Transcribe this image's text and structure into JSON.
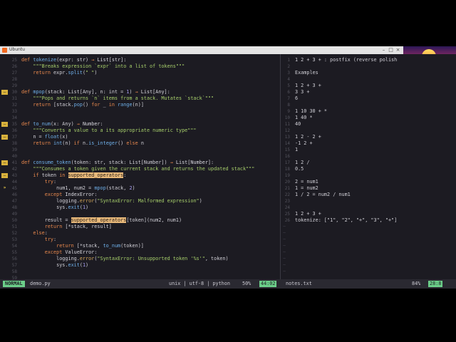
{
  "window": {
    "title": "Ubuntu"
  },
  "left_pane": {
    "lines": [
      {
        "sign": "",
        "num": "25",
        "segs": [
          {
            "c": "kw",
            "t": "def "
          },
          {
            "c": "fn",
            "t": "tokenize"
          },
          {
            "c": "",
            "t": "(expr: str) "
          },
          {
            "c": "kw",
            "t": "→ "
          },
          {
            "c": "ty",
            "t": "List[str]:"
          }
        ]
      },
      {
        "sign": "",
        "num": "26",
        "segs": [
          {
            "c": "str",
            "t": "    \"\"\"Breaks expression `expr` into a list of tokens\"\"\""
          }
        ]
      },
      {
        "sign": "",
        "num": "27",
        "segs": [
          {
            "c": "kw",
            "t": "    return "
          },
          {
            "c": "",
            "t": "expr."
          },
          {
            "c": "fn",
            "t": "split"
          },
          {
            "c": "",
            "t": "("
          },
          {
            "c": "str",
            "t": "\" \""
          },
          {
            "c": "",
            "t": ")"
          }
        ]
      },
      {
        "sign": "",
        "num": "28",
        "segs": []
      },
      {
        "sign": "",
        "num": "29",
        "segs": []
      },
      {
        "sign": "warn",
        "num": "30",
        "segs": [
          {
            "c": "kw",
            "t": "def "
          },
          {
            "c": "fn",
            "t": "mpop"
          },
          {
            "c": "",
            "t": "(stack: List[Any], n: int = "
          },
          {
            "c": "lit",
            "t": "1"
          },
          {
            "c": "",
            "t": ") "
          },
          {
            "c": "kw",
            "t": "→ "
          },
          {
            "c": "ty",
            "t": "List[Any]:"
          }
        ]
      },
      {
        "sign": "",
        "num": "31",
        "segs": [
          {
            "c": "str",
            "t": "    \"\"\"Pops and returns `n` items from a stack. Mutates `stack`\"\"\""
          }
        ]
      },
      {
        "sign": "",
        "num": "32",
        "segs": [
          {
            "c": "kw",
            "t": "    return "
          },
          {
            "c": "",
            "t": "[stack."
          },
          {
            "c": "fn",
            "t": "pop"
          },
          {
            "c": "",
            "t": "() "
          },
          {
            "c": "kw",
            "t": "for "
          },
          {
            "c": "",
            "t": "_ "
          },
          {
            "c": "kw",
            "t": "in "
          },
          {
            "c": "fn",
            "t": "range"
          },
          {
            "c": "",
            "t": "(n)]"
          }
        ]
      },
      {
        "sign": "",
        "num": "33",
        "segs": []
      },
      {
        "sign": "",
        "num": "34",
        "segs": []
      },
      {
        "sign": "warn",
        "num": "35",
        "segs": [
          {
            "c": "kw",
            "t": "def "
          },
          {
            "c": "fn",
            "t": "to_num"
          },
          {
            "c": "",
            "t": "(x: Any) "
          },
          {
            "c": "kw",
            "t": "→ "
          },
          {
            "c": "ty",
            "t": "Number:"
          }
        ]
      },
      {
        "sign": "",
        "num": "36",
        "segs": [
          {
            "c": "str",
            "t": "    \"\"\"Converts a value to a its appropriate numeric type\"\"\""
          }
        ]
      },
      {
        "sign": "warn",
        "num": "37",
        "segs": [
          {
            "c": "",
            "t": "    n = "
          },
          {
            "c": "fn",
            "t": "float"
          },
          {
            "c": "",
            "t": "(x)"
          }
        ]
      },
      {
        "sign": "",
        "num": "38",
        "segs": [
          {
            "c": "kw",
            "t": "    return "
          },
          {
            "c": "fn",
            "t": "int"
          },
          {
            "c": "",
            "t": "(n) "
          },
          {
            "c": "kw",
            "t": "if "
          },
          {
            "c": "",
            "t": "n."
          },
          {
            "c": "fn",
            "t": "is_integer"
          },
          {
            "c": "",
            "t": "() "
          },
          {
            "c": "kw",
            "t": "else "
          },
          {
            "c": "",
            "t": "n"
          }
        ]
      },
      {
        "sign": "",
        "num": "39",
        "segs": []
      },
      {
        "sign": "",
        "num": "40",
        "segs": []
      },
      {
        "sign": "warn",
        "num": "41",
        "segs": [
          {
            "c": "kw",
            "t": "def "
          },
          {
            "c": "fn",
            "t": "consume_token"
          },
          {
            "c": "",
            "t": "(token: str, stack: List[Number]) "
          },
          {
            "c": "kw",
            "t": "→ "
          },
          {
            "c": "ty",
            "t": "List[Number]:"
          }
        ]
      },
      {
        "sign": "",
        "num": "42",
        "segs": [
          {
            "c": "str",
            "t": "    \"\"\"Consumes a token given the current stack and returns the updated stack\"\"\""
          }
        ]
      },
      {
        "sign": "warn",
        "num": "43",
        "segs": [
          {
            "c": "kw",
            "t": "    if "
          },
          {
            "c": "",
            "t": "token "
          },
          {
            "c": "kw",
            "t": "in "
          },
          {
            "c": "hl",
            "t": "supported_operators"
          },
          {
            "c": "",
            "t": ":"
          }
        ]
      },
      {
        "sign": "",
        "num": "44",
        "segs": [
          {
            "c": "kw",
            "t": "        try"
          },
          {
            "c": "",
            "t": ":"
          }
        ]
      },
      {
        "sign": "arrow",
        "num": "45",
        "segs": [
          {
            "c": "",
            "t": "            num1, num2 = "
          },
          {
            "c": "fn",
            "t": "mpop"
          },
          {
            "c": "",
            "t": "(stack, "
          },
          {
            "c": "lit",
            "t": "2"
          },
          {
            "c": "",
            "t": ")"
          }
        ]
      },
      {
        "sign": "",
        "num": "46",
        "segs": [
          {
            "c": "kw",
            "t": "        except "
          },
          {
            "c": "ty",
            "t": "IndexError"
          },
          {
            "c": "",
            "t": ":"
          }
        ]
      },
      {
        "sign": "",
        "num": "47",
        "segs": [
          {
            "c": "",
            "t": "            logging."
          },
          {
            "c": "ec",
            "t": "error"
          },
          {
            "c": "",
            "t": "("
          },
          {
            "c": "str",
            "t": "\"SyntaxError: Malformed expression\""
          },
          {
            "c": "",
            "t": ")"
          }
        ]
      },
      {
        "sign": "",
        "num": "48",
        "segs": [
          {
            "c": "",
            "t": "            sys."
          },
          {
            "c": "fn",
            "t": "exit"
          },
          {
            "c": "",
            "t": "("
          },
          {
            "c": "lit",
            "t": "1"
          },
          {
            "c": "",
            "t": ")"
          }
        ]
      },
      {
        "sign": "",
        "num": "49",
        "segs": []
      },
      {
        "sign": "",
        "num": "50",
        "segs": [
          {
            "c": "",
            "t": "        result = "
          },
          {
            "c": "hl",
            "t": "supported_operators"
          },
          {
            "c": "",
            "t": "[token](num2, num1)"
          }
        ]
      },
      {
        "sign": "",
        "num": "51",
        "segs": [
          {
            "c": "kw",
            "t": "        return "
          },
          {
            "c": "",
            "t": "[*stack, result]"
          }
        ]
      },
      {
        "sign": "",
        "num": "52",
        "segs": [
          {
            "c": "kw",
            "t": "    else"
          },
          {
            "c": "",
            "t": ":"
          }
        ]
      },
      {
        "sign": "",
        "num": "53",
        "segs": [
          {
            "c": "kw",
            "t": "        try"
          },
          {
            "c": "",
            "t": ":"
          }
        ]
      },
      {
        "sign": "",
        "num": "54",
        "segs": [
          {
            "c": "kw",
            "t": "            return "
          },
          {
            "c": "",
            "t": "[*stack, "
          },
          {
            "c": "fn",
            "t": "to_num"
          },
          {
            "c": "",
            "t": "(token)]"
          }
        ]
      },
      {
        "sign": "",
        "num": "55",
        "segs": [
          {
            "c": "kw",
            "t": "        except "
          },
          {
            "c": "ty",
            "t": "ValueError"
          },
          {
            "c": "",
            "t": ":"
          }
        ]
      },
      {
        "sign": "",
        "num": "56",
        "segs": [
          {
            "c": "",
            "t": "            logging."
          },
          {
            "c": "ec",
            "t": "error"
          },
          {
            "c": "",
            "t": "("
          },
          {
            "c": "str",
            "t": "\"SyntaxError: Unsupported token '%s'\""
          },
          {
            "c": "",
            "t": ", token)"
          }
        ]
      },
      {
        "sign": "",
        "num": "57",
        "segs": [
          {
            "c": "",
            "t": "            sys."
          },
          {
            "c": "fn",
            "t": "exit"
          },
          {
            "c": "",
            "t": "("
          },
          {
            "c": "lit",
            "t": "1"
          },
          {
            "c": "",
            "t": ")"
          }
        ]
      },
      {
        "sign": "",
        "num": "58",
        "segs": []
      },
      {
        "sign": "",
        "num": "59",
        "segs": []
      }
    ]
  },
  "right_pane": {
    "lines": [
      {
        "num": "1",
        "text": "1 2 + 3 + : postfix (reverse polish"
      },
      {
        "num": "2",
        "text": ""
      },
      {
        "num": "3",
        "text": "Examples"
      },
      {
        "num": "4",
        "text": ""
      },
      {
        "num": "5",
        "text": "1 2 + 3 +"
      },
      {
        "num": "6",
        "text": "3 3 +"
      },
      {
        "num": "7",
        "text": "6"
      },
      {
        "num": "8",
        "text": ""
      },
      {
        "num": "9",
        "text": "1 10 30 + *"
      },
      {
        "num": "10",
        "text": "1 40 *"
      },
      {
        "num": "11",
        "text": "40"
      },
      {
        "num": "12",
        "text": ""
      },
      {
        "num": "13",
        "text": "1 2 - 2 +"
      },
      {
        "num": "14",
        "text": "-1 2 +"
      },
      {
        "num": "15",
        "text": "1"
      },
      {
        "num": "16",
        "text": ""
      },
      {
        "num": "17",
        "text": "1 2 /"
      },
      {
        "num": "18",
        "text": "0.5"
      },
      {
        "num": "19",
        "text": ""
      },
      {
        "num": "20",
        "text": "2 = num1"
      },
      {
        "num": "21",
        "text": "1 = num2"
      },
      {
        "num": "22",
        "text": "1 / 2 = num2 / num1"
      },
      {
        "num": "23",
        "text": ""
      },
      {
        "num": "24",
        "text": ""
      },
      {
        "num": "25",
        "text": "1 2 + 3 +"
      },
      {
        "num": "26",
        "text": "tokenize: [\"1\", \"2\", \"+\", \"3\", \"+\"]"
      }
    ],
    "tilde_lines": 8
  },
  "statusline": {
    "mode": "NORMAL",
    "filename": "demo.py",
    "encoding_info": "unix | utf-8 | python",
    "percent": "50%",
    "position": "44:02",
    "right_filename": "notes.txt",
    "right_percent": "84%",
    "right_position": "28:8"
  },
  "colors": {
    "accent": "#6ccf8a",
    "warning_sign": "#d9b23c",
    "background": "#1c1b22"
  }
}
